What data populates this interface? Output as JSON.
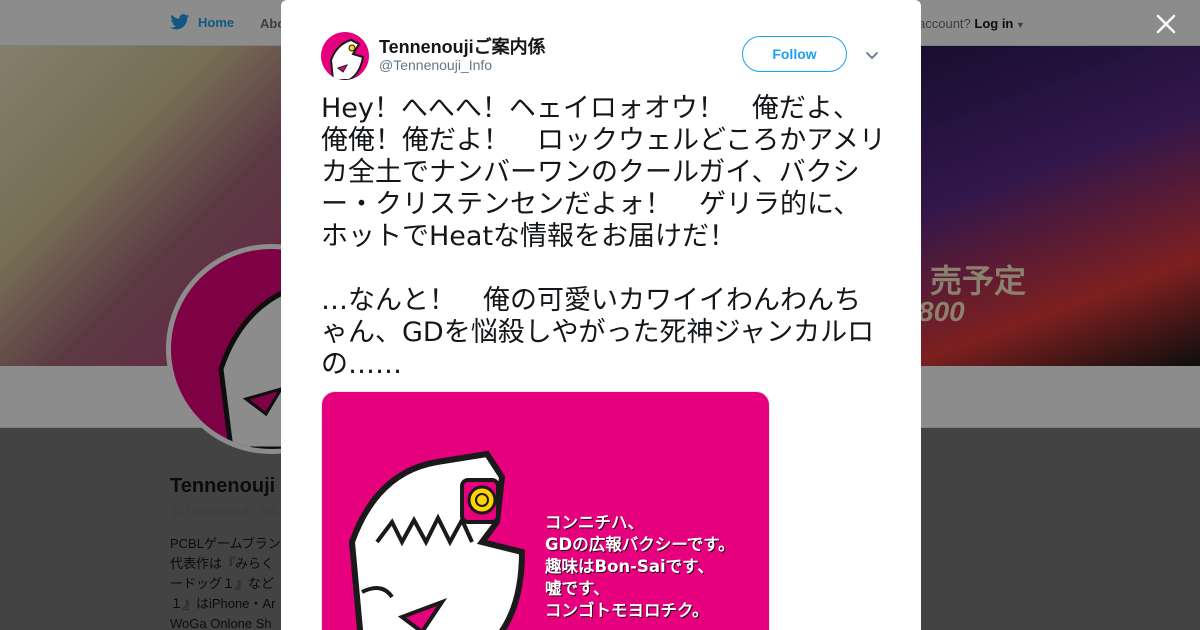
{
  "nav": {
    "home_label": "Home",
    "about_label": "Abo",
    "login_prefix": "account?",
    "login_label": "Log in"
  },
  "profile": {
    "name": "Tennenouji",
    "handle": "@Tennenouji_Info",
    "bio": "PCBLゲームブラン\n代表作は『みらく\nードッグ１』など\n１』はiPhone・Ar\nWoGa Onlone Sh"
  },
  "banner": {
    "text_line1": "売予定",
    "text_line2": "800"
  },
  "tweet": {
    "author_name": "Tennenoujiご案内係",
    "author_handle": "@Tennenouji_Info",
    "follow_label": "Follow",
    "text": "Hey！へへへ！ヘェイロォオウ！　俺だよ、俺俺！俺だよ！　ロックウェルどころかアメリカ全土でナンバーワンのクールガイ、バクシー・クリステンセンだよォ！　ゲリラ的に、ホットでHeatな情報をお届けだ！\n\n…なんと！　俺の可愛いカワイイわんわんちゃん、GDを悩殺しやがった死神ジャンカルロの……",
    "media_text": "コンニチハ、\nGDの広報バクシーです。\n趣味はBon-Saiです、\n嘘です、\nコンゴトモヨロチク。"
  },
  "colors": {
    "brand_blue": "#1da1f2",
    "media_pink": "#e6007e",
    "text_dark": "#14171a",
    "text_muted": "#657786"
  },
  "icons": {
    "close": "close-icon",
    "caret": "chevron-down-icon",
    "bird": "twitter-bird-icon"
  }
}
